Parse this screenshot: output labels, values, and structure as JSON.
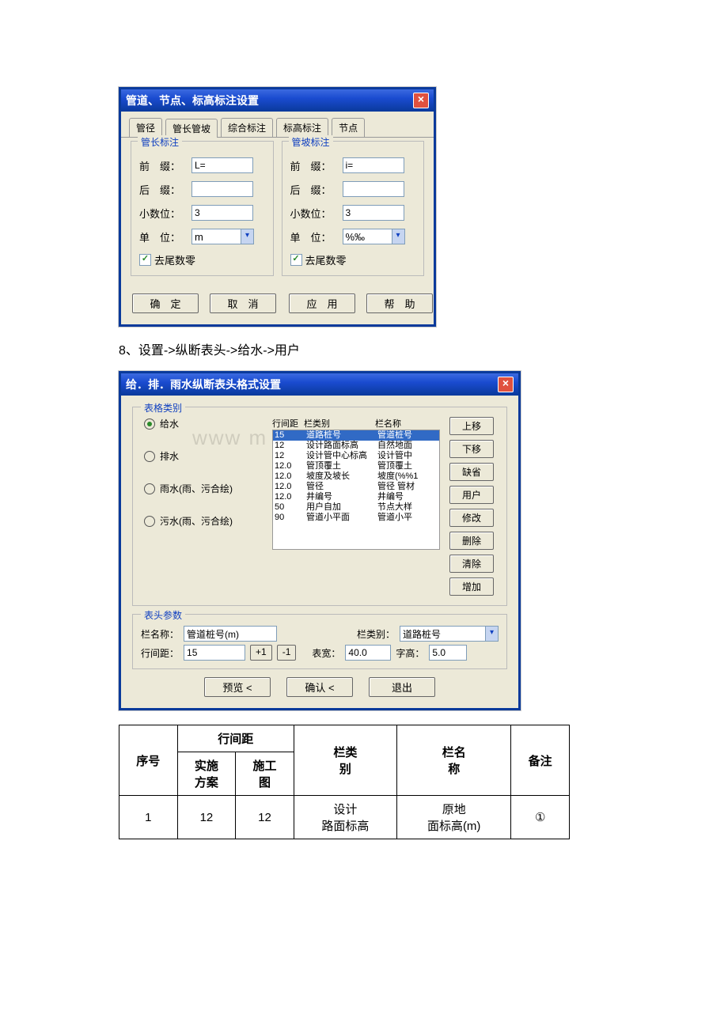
{
  "dialog1": {
    "title": "管道、节点、标高标注设置",
    "tabs": [
      "管径",
      "管长管坡",
      "综合标注",
      "标高标注",
      "节点"
    ],
    "active_tab": 1,
    "group1": {
      "title": "管长标注",
      "prefix_label": "前　缀：",
      "prefix_value": "L=",
      "suffix_label": "后　缀：",
      "suffix_value": "",
      "decimals_label": "小数位：",
      "decimals_value": "3",
      "unit_label": "单　位：",
      "unit_value": "m",
      "trim_label": "去尾数零"
    },
    "group2": {
      "title": "管坡标注",
      "prefix_label": "前　缀：",
      "prefix_value": "i=",
      "suffix_label": "后　缀：",
      "suffix_value": "",
      "decimals_label": "小数位：",
      "decimals_value": "3",
      "unit_label": "单　位：",
      "unit_value": "%‰",
      "trim_label": "去尾数零"
    },
    "buttons": {
      "ok": "确　定",
      "cancel": "取　消",
      "apply": "应　用",
      "help": "帮　助"
    }
  },
  "doc_line": "8、设置->纵断表头->给水->用户",
  "dialog2": {
    "title": "给．排．雨水纵断表头格式设置",
    "category_label": "表格类别",
    "radios": [
      {
        "label": "给水",
        "selected": true
      },
      {
        "label": "排水",
        "selected": false
      },
      {
        "label": "雨水(雨、污合绘)",
        "selected": false
      },
      {
        "label": "污水(雨、污合绘)",
        "selected": false
      }
    ],
    "list_headers": [
      "行间距",
      "栏类别",
      "栏名称"
    ],
    "rows": [
      {
        "span": "15",
        "type": "道路桩号",
        "name": "管道桩号",
        "selected": true
      },
      {
        "span": "12",
        "type": "设计路面标高",
        "name": "自然地面"
      },
      {
        "span": "12",
        "type": "设计管中心标高",
        "name": "设计管中"
      },
      {
        "span": "12.0",
        "type": "管顶覆土",
        "name": "管顶覆土"
      },
      {
        "span": "12.0",
        "type": "坡度及坡长",
        "name": "坡度(%%1"
      },
      {
        "span": "12.0",
        "type": "管径",
        "name": "管径 管材"
      },
      {
        "span": "12.0",
        "type": "井编号",
        "name": "井编号"
      },
      {
        "span": "50",
        "type": "用户自加",
        "name": "节点大样"
      },
      {
        "span": "90",
        "type": "管道小平面",
        "name": "管道小平"
      }
    ],
    "sidebtns": [
      "上移",
      "下移",
      "缺省",
      "用户",
      "修改",
      "删除",
      "清除",
      "增加"
    ],
    "params": {
      "title": "表头参数",
      "name_label": "栏名称：",
      "name_value": "管道桩号(m)",
      "type_label": "栏类别：",
      "type_value": "道路桩号",
      "span_label": "行间距：",
      "span_value": "15",
      "plus1": "+1",
      "minus1": "-1",
      "tw_label": "表宽：",
      "tw_value": "40.0",
      "fh_label": "字高：",
      "fh_value": "5.0"
    },
    "actions": {
      "preview": "预览 <",
      "confirm": "确认 <",
      "exit": "退出"
    }
  },
  "table": {
    "head": {
      "seq": "序号",
      "span": "行间距",
      "plan": "实施\n方案",
      "cons": "施工\n图",
      "type": "栏类\n别",
      "name": "栏名\n称",
      "note": "备注"
    },
    "row": {
      "seq": "1",
      "plan": "12",
      "cons": "12",
      "type": "设计\n路面标高",
      "name": "原地\n面标高(m)",
      "note": "①"
    }
  },
  "watermark": "www                  m"
}
